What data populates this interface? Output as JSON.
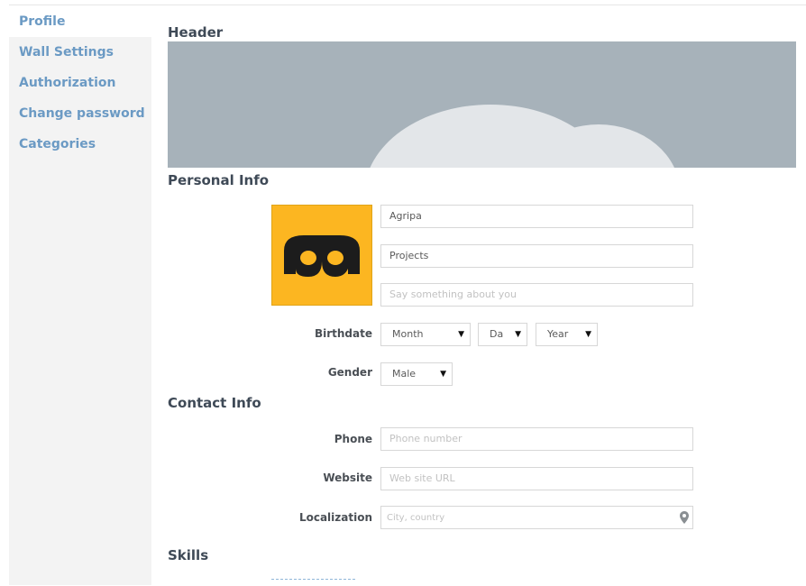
{
  "sidebar": {
    "items": [
      {
        "label": "Profile"
      },
      {
        "label": "Wall Settings"
      },
      {
        "label": "Authorization"
      },
      {
        "label": "Change password"
      },
      {
        "label": "Categories"
      }
    ]
  },
  "sections": {
    "header": "Header",
    "personal": "Personal Info",
    "contact": "Contact Info",
    "skills": "Skills"
  },
  "personal": {
    "first_name": "Agripa",
    "last_name": "Projects",
    "about_placeholder": "Say something about you",
    "birthdate_label": "Birthdate",
    "month": "Month",
    "day": "Da",
    "year": "Year",
    "gender_label": "Gender",
    "gender": "Male"
  },
  "contact": {
    "phone_label": "Phone",
    "phone_placeholder": "Phone number",
    "website_label": "Website",
    "website_placeholder": "Web site URL",
    "localization_label": "Localization",
    "localization_placeholder": "City, country"
  },
  "colors": {
    "accent": "#6b9ac4",
    "avatar_bg": "#fcb621",
    "banner": "#a7b2ba"
  }
}
